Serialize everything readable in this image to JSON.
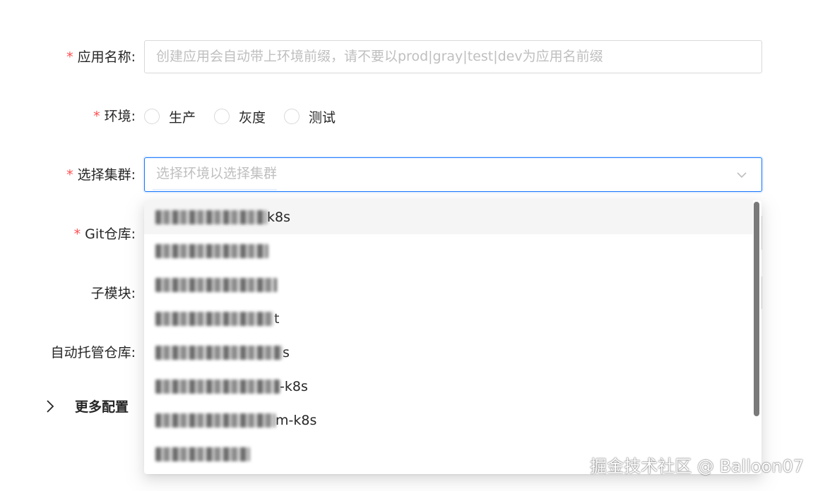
{
  "form": {
    "app_name": {
      "label": "应用名称:",
      "placeholder": "创建应用会自动带上环境前缀，请不要以prod|gray|test|dev为应用名前缀"
    },
    "env": {
      "label": "环境:",
      "options": [
        "生产",
        "灰度",
        "测试"
      ]
    },
    "cluster": {
      "label": "选择集群:",
      "placeholder": "选择环境以选择集群"
    },
    "git_repo": {
      "label": "Git仓库:"
    },
    "submodule": {
      "label": "子模块:"
    },
    "auto_repo": {
      "label": "自动托管仓库:"
    },
    "more_config": {
      "label": "更多配置"
    }
  },
  "dropdown": {
    "options": [
      {
        "suffix": "k8s",
        "blur": 158
      },
      {
        "suffix": "",
        "blur": 160
      },
      {
        "suffix": "",
        "blur": 172
      },
      {
        "suffix": "t",
        "blur": 168
      },
      {
        "suffix": "s",
        "blur": 180
      },
      {
        "suffix": "-k8s",
        "blur": 176
      },
      {
        "suffix": "m-k8s",
        "blur": 170
      },
      {
        "suffix": "",
        "blur": 134
      }
    ]
  },
  "watermark": "掘金技术社区 @ Balloon07",
  "colors": {
    "required": "#ff4d4f",
    "accent": "#1677ff",
    "text": "#262626",
    "placeholder": "#bfbfbf"
  }
}
